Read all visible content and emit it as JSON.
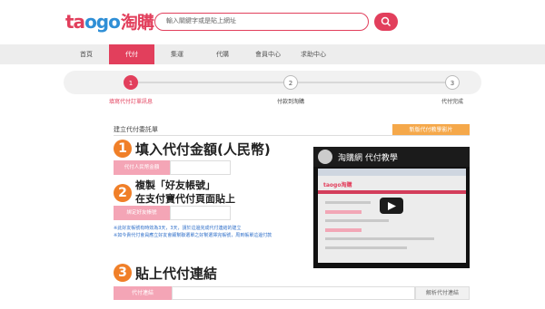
{
  "header": {
    "logo_ta": "ta",
    "logo_ogo": "ogo",
    "logo_cn": "淘購",
    "search_placeholder": "輸入關鍵字或是貼上網址"
  },
  "nav": {
    "items": [
      {
        "label": "首頁"
      },
      {
        "label": "代付",
        "active": true
      },
      {
        "label": "集運"
      },
      {
        "label": "代購"
      },
      {
        "label": "會員中心"
      },
      {
        "label": "求助中心"
      }
    ]
  },
  "progress": {
    "steps": [
      {
        "num": "1",
        "label": "填寫代付訂單訊息"
      },
      {
        "num": "2",
        "label": "付款到淘購"
      },
      {
        "num": "3",
        "label": "代付完成"
      }
    ],
    "completed_fraction": 0.0
  },
  "form": {
    "section_title": "建立代付委託單",
    "tutorial_button": "新版代付教學影片",
    "step1_num": "1",
    "step1_title": "填入代付金額(人民幣)",
    "amount_label": "代付人民幣金額",
    "step2_num": "2",
    "step2_line1": "複製「好友帳號」",
    "step2_line2": "在支付寶代付頁面貼上",
    "friend_account_label": "綁定好友帳號",
    "note1": "※此好友帳號有時效為3天，3天，請於這邊完成代付連結的建立",
    "note2": "※如今貴代付會員應立好友會顯幫聯選單之好幫選擇完帳號，周到帳單這邊付款",
    "step3_num": "3",
    "step3_title": "貼上代付連結",
    "link_label": "代付連結",
    "parse_button": "解析代付連結"
  },
  "video": {
    "title": "淘購網 代付教學",
    "screen_logo": "taogo淘購"
  },
  "colors": {
    "brand_red": "#e23f5c",
    "brand_blue": "#2f8fd6",
    "accent_orange": "#f07f28",
    "tutorial_orange": "#f5a84a",
    "field_label_pink": "#f4a5b6"
  }
}
